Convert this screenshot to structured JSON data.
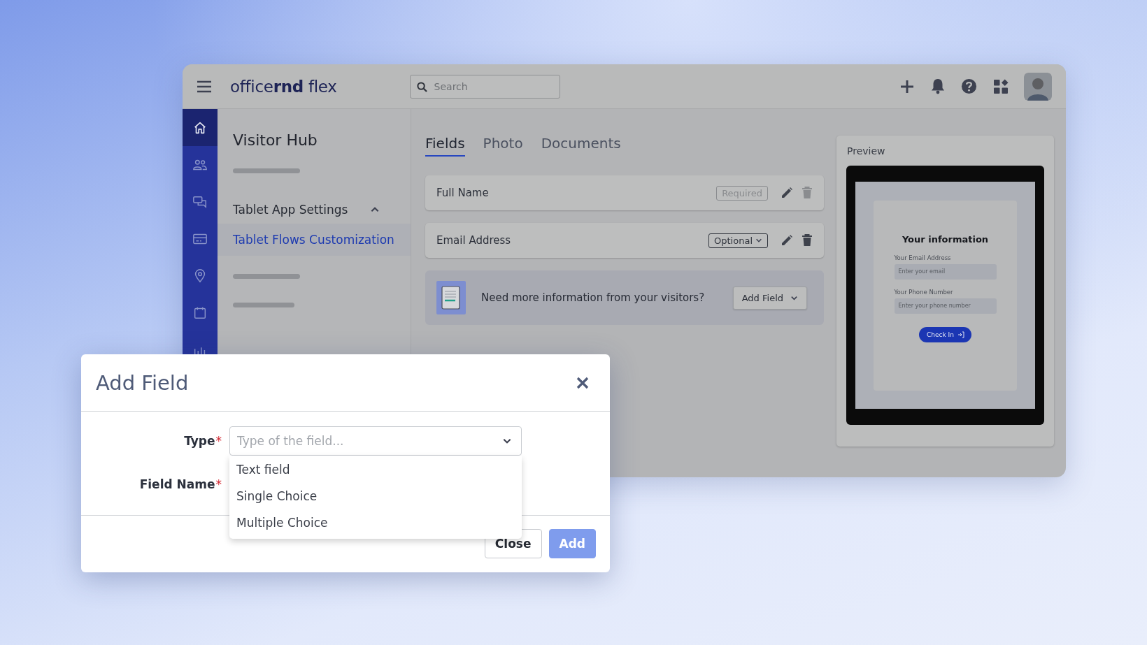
{
  "app": {
    "logo": "office**rnd** flex",
    "search": {
      "placeholder": "Search"
    },
    "rail": [
      {
        "selected": true
      },
      {
        "selected": false
      },
      {
        "selected": false
      },
      {
        "selected": false
      },
      {
        "selected": false
      },
      {
        "selected": false
      },
      {
        "selected": false
      }
    ],
    "nav": {
      "title": "Visitor Hub",
      "items": [
        {
          "kind": "skeleton"
        },
        {
          "kind": "group",
          "label": "Tablet App Settings",
          "expanded": true,
          "children": [
            {
              "label": "Tablet Flows Customization",
              "selected": true
            }
          ]
        },
        {
          "kind": "skeleton"
        },
        {
          "kind": "skeleton"
        }
      ]
    },
    "tabs": [
      {
        "label": "Fields",
        "selected": true
      },
      {
        "label": "Photo",
        "selected": false
      },
      {
        "label": "Documents",
        "selected": false
      }
    ],
    "fields": [
      {
        "label": "Full Name",
        "status": "Required",
        "locked": true
      },
      {
        "label": "Email Address",
        "status": "Optional",
        "locked": false
      }
    ],
    "promo": {
      "text": "Need more information from your visitors?",
      "button": "Add Field"
    },
    "preview": {
      "title": "Preview",
      "heading": "Your information",
      "fields": [
        {
          "label": "Your Email Address",
          "placeholder": "Enter your email"
        },
        {
          "label": "Your Phone Number",
          "placeholder": "Enter your phone number"
        }
      ],
      "button": "Check In"
    }
  },
  "modal": {
    "title": "Add Field",
    "required_mark": "*",
    "fields": [
      {
        "label": "Type",
        "required": true,
        "placeholder": "Type of the field..."
      },
      {
        "label": "Field Name",
        "required": true
      }
    ],
    "options": [
      {
        "label": "Text field",
        "selected": false
      },
      {
        "label": "Single Choice",
        "selected": false
      },
      {
        "label": "Multiple Choice",
        "selected": false
      }
    ],
    "buttons": [
      {
        "label": "Close",
        "kind": "secondary"
      },
      {
        "label": "Add",
        "kind": "primary"
      }
    ]
  }
}
